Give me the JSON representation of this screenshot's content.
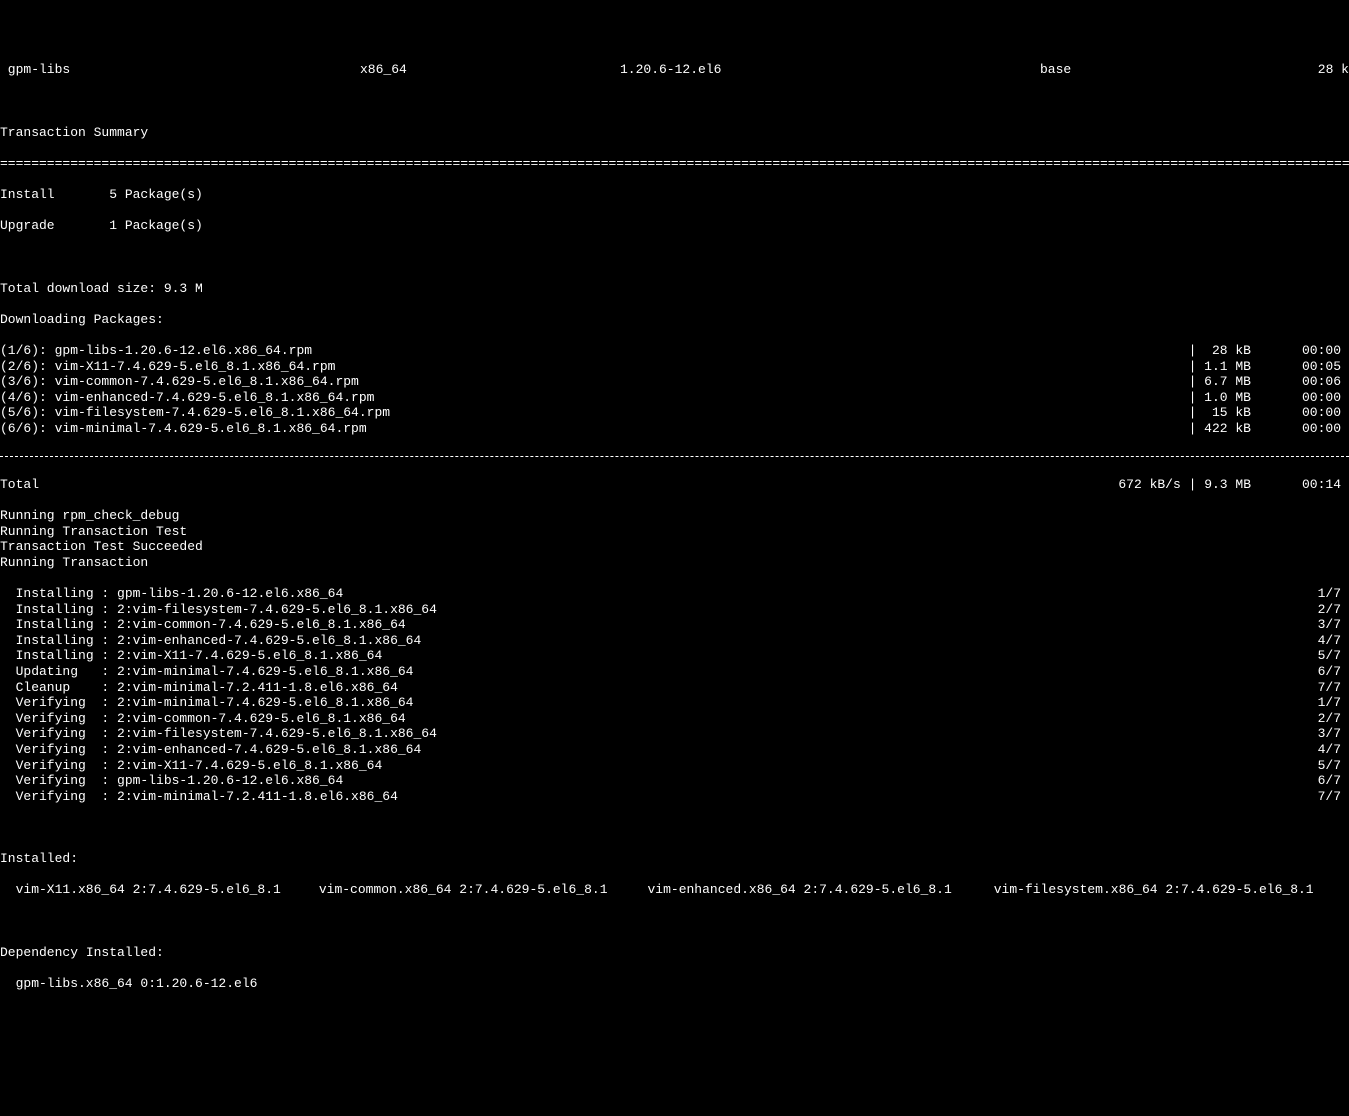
{
  "pkgRow": {
    "name": " gpm-libs",
    "arch": "x86_64",
    "version": "1.20.6-12.el6",
    "repo": "base",
    "size": "28 k"
  },
  "summary": {
    "header": "Transaction Summary",
    "doubleLine": "=========================================================================================================================================================================================",
    "installLabel": "Install       5 Package(s)",
    "upgradeLabel": "Upgrade       1 Package(s)"
  },
  "download": {
    "totalSize": "Total download size: 9.3 M",
    "startLabel": "Downloading Packages:",
    "rows": [
      {
        "name": "(1/6): gpm-libs-1.20.6-12.el6.x86_64.rpm",
        "size": "|  28 kB",
        "time": "00:00"
      },
      {
        "name": "(2/6): vim-X11-7.4.629-5.el6_8.1.x86_64.rpm",
        "size": "| 1.1 MB",
        "time": "00:05"
      },
      {
        "name": "(3/6): vim-common-7.4.629-5.el6_8.1.x86_64.rpm",
        "size": "| 6.7 MB",
        "time": "00:06"
      },
      {
        "name": "(4/6): vim-enhanced-7.4.629-5.el6_8.1.x86_64.rpm",
        "size": "| 1.0 MB",
        "time": "00:00"
      },
      {
        "name": "(5/6): vim-filesystem-7.4.629-5.el6_8.1.x86_64.rpm",
        "size": "|  15 kB",
        "time": "00:00"
      },
      {
        "name": "(6/6): vim-minimal-7.4.629-5.el6_8.1.x86_64.rpm",
        "size": "| 422 kB",
        "time": "00:00"
      }
    ],
    "totalRow": {
      "name": "Total",
      "size": "672 kB/s | 9.3 MB",
      "time": "00:14"
    }
  },
  "checks": [
    "Running rpm_check_debug",
    "Running Transaction Test",
    "Transaction Test Succeeded",
    "Running Transaction"
  ],
  "actions": [
    {
      "left": "  Installing : gpm-libs-1.20.6-12.el6.x86_64",
      "right": "1/7"
    },
    {
      "left": "  Installing : 2:vim-filesystem-7.4.629-5.el6_8.1.x86_64",
      "right": "2/7"
    },
    {
      "left": "  Installing : 2:vim-common-7.4.629-5.el6_8.1.x86_64",
      "right": "3/7"
    },
    {
      "left": "  Installing : 2:vim-enhanced-7.4.629-5.el6_8.1.x86_64",
      "right": "4/7"
    },
    {
      "left": "  Installing : 2:vim-X11-7.4.629-5.el6_8.1.x86_64",
      "right": "5/7"
    },
    {
      "left": "  Updating   : 2:vim-minimal-7.4.629-5.el6_8.1.x86_64",
      "right": "6/7"
    },
    {
      "left": "  Cleanup    : 2:vim-minimal-7.2.411-1.8.el6.x86_64",
      "right": "7/7"
    },
    {
      "left": "  Verifying  : 2:vim-minimal-7.4.629-5.el6_8.1.x86_64",
      "right": "1/7"
    },
    {
      "left": "  Verifying  : 2:vim-common-7.4.629-5.el6_8.1.x86_64",
      "right": "2/7"
    },
    {
      "left": "  Verifying  : 2:vim-filesystem-7.4.629-5.el6_8.1.x86_64",
      "right": "3/7"
    },
    {
      "left": "  Verifying  : 2:vim-enhanced-7.4.629-5.el6_8.1.x86_64",
      "right": "4/7"
    },
    {
      "left": "  Verifying  : 2:vim-X11-7.4.629-5.el6_8.1.x86_64",
      "right": "5/7"
    },
    {
      "left": "  Verifying  : gpm-libs-1.20.6-12.el6.x86_64",
      "right": "6/7"
    },
    {
      "left": "  Verifying  : 2:vim-minimal-7.2.411-1.8.el6.x86_64",
      "right": "7/7"
    }
  ],
  "installed": {
    "header": "Installed:",
    "items": [
      "vim-X11.x86_64 2:7.4.629-5.el6_8.1",
      "vim-common.x86_64 2:7.4.629-5.el6_8.1",
      "vim-enhanced.x86_64 2:7.4.629-5.el6_8.1",
      "vim-filesystem.x86_64 2:7.4.629-5.el6_8.1"
    ]
  },
  "depInstalled": {
    "header": "Dependency Installed:",
    "item": "gpm-libs.x86_64 0:1.20.6-12.el6"
  }
}
